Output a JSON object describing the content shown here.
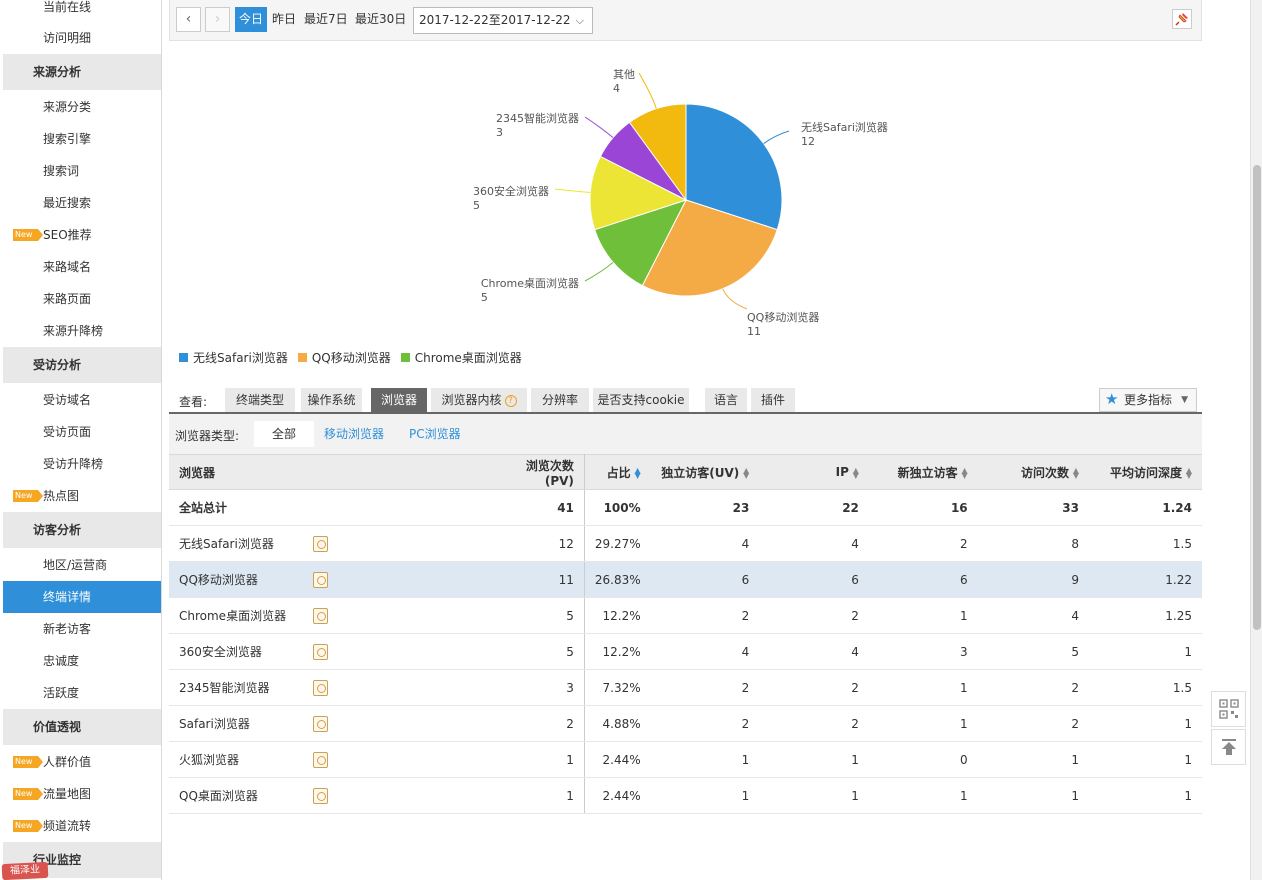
{
  "sidebar": {
    "items": [
      {
        "type": "item",
        "label": "当前在线"
      },
      {
        "type": "item",
        "label": "访问明细"
      },
      {
        "type": "group",
        "label": "来源分析"
      },
      {
        "type": "item",
        "label": "来源分类"
      },
      {
        "type": "item",
        "label": "搜索引擎"
      },
      {
        "type": "item",
        "label": "搜索词"
      },
      {
        "type": "item",
        "label": "最近搜索"
      },
      {
        "type": "item",
        "label": "SEO推荐",
        "new": true
      },
      {
        "type": "item",
        "label": "来路域名"
      },
      {
        "type": "item",
        "label": "来路页面"
      },
      {
        "type": "item",
        "label": "来源升降榜"
      },
      {
        "type": "group",
        "label": "受访分析"
      },
      {
        "type": "item",
        "label": "受访域名"
      },
      {
        "type": "item",
        "label": "受访页面"
      },
      {
        "type": "item",
        "label": "受访升降榜"
      },
      {
        "type": "item",
        "label": "热点图",
        "new": true
      },
      {
        "type": "group",
        "label": "访客分析"
      },
      {
        "type": "item",
        "label": "地区/运营商"
      },
      {
        "type": "item",
        "label": "终端详情",
        "active": true
      },
      {
        "type": "item",
        "label": "新老访客"
      },
      {
        "type": "item",
        "label": "忠诚度"
      },
      {
        "type": "item",
        "label": "活跃度"
      },
      {
        "type": "group",
        "label": "价值透视"
      },
      {
        "type": "item",
        "label": "人群价值",
        "new": true
      },
      {
        "type": "item",
        "label": "流量地图",
        "new": true
      },
      {
        "type": "item",
        "label": "频道流转",
        "new": true
      },
      {
        "type": "group",
        "label": "行业监控"
      }
    ],
    "new_badge": "New",
    "watermark": "福泽业"
  },
  "toolbar": {
    "prev": "‹",
    "next": "›",
    "ranges": [
      "今日",
      "昨日",
      "最近7日",
      "最近30日"
    ],
    "active_range": "今日",
    "date_range": "2017-12-22至2017-12-22"
  },
  "chart_data": {
    "type": "pie",
    "slices": [
      {
        "label": "无线Safari浏览器",
        "value": 12,
        "color": "#2f8fd8"
      },
      {
        "label": "QQ移动浏览器",
        "value": 11,
        "color": "#f5ab45"
      },
      {
        "label": "Chrome桌面浏览器",
        "value": 5,
        "color": "#6fbf3b"
      },
      {
        "label": "360安全浏览器",
        "value": 5,
        "color": "#ece535"
      },
      {
        "label": "2345智能浏览器",
        "value": 3,
        "color": "#9b45d6"
      },
      {
        "label": "其他",
        "value": 4,
        "color": "#f2b90f"
      }
    ],
    "legend": [
      "无线Safari浏览器",
      "QQ移动浏览器",
      "Chrome桌面浏览器"
    ],
    "legend_position": "bottom-left"
  },
  "tabs": {
    "view_label": "查看:",
    "items": [
      "终端类型",
      "操作系统",
      "浏览器",
      "浏览器内核",
      "分辨率",
      "是否支持cookie",
      "语言",
      "插件"
    ],
    "active": "浏览器",
    "help_mark": "?",
    "more_metrics": "更多指标"
  },
  "filter": {
    "label": "浏览器类型:",
    "options": [
      "全部",
      "移动浏览器",
      "PC浏览器"
    ],
    "active": "全部"
  },
  "table": {
    "headers": [
      "浏览器",
      "浏览次数(PV)",
      "占比",
      "独立访客(UV)",
      "IP",
      "新独立访客",
      "访问次数",
      "平均访问深度"
    ],
    "total": [
      "全站总计",
      "41",
      "100%",
      "23",
      "22",
      "16",
      "33",
      "1.24"
    ],
    "rows": [
      [
        "无线Safari浏览器",
        "12",
        "29.27%",
        "4",
        "4",
        "2",
        "8",
        "1.5"
      ],
      [
        "QQ移动浏览器",
        "11",
        "26.83%",
        "6",
        "6",
        "6",
        "9",
        "1.22"
      ],
      [
        "Chrome桌面浏览器",
        "5",
        "12.2%",
        "2",
        "2",
        "1",
        "4",
        "1.25"
      ],
      [
        "360安全浏览器",
        "5",
        "12.2%",
        "4",
        "4",
        "3",
        "5",
        "1"
      ],
      [
        "2345智能浏览器",
        "3",
        "7.32%",
        "2",
        "2",
        "1",
        "2",
        "1.5"
      ],
      [
        "Safari浏览器",
        "2",
        "4.88%",
        "2",
        "2",
        "1",
        "2",
        "1"
      ],
      [
        "火狐浏览器",
        "1",
        "2.44%",
        "1",
        "1",
        "0",
        "1",
        "1"
      ],
      [
        "QQ桌面浏览器",
        "1",
        "2.44%",
        "1",
        "1",
        "1",
        "1",
        "1"
      ]
    ],
    "highlight_row": 1
  },
  "float_tools": {
    "qr": "▦",
    "top": "⇧"
  }
}
